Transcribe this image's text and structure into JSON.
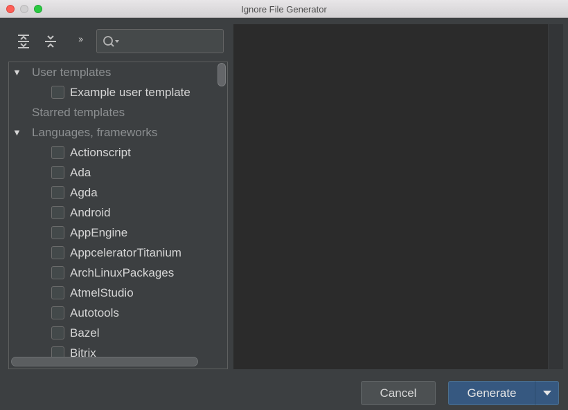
{
  "window": {
    "title": "Ignore File Generator"
  },
  "toolbar": {
    "overflow_label": "››"
  },
  "search": {
    "value": "",
    "placeholder": ""
  },
  "tree": {
    "groups": [
      {
        "label": "User templates",
        "expanded": true,
        "items": [
          "Example user template"
        ]
      },
      {
        "label": "Starred templates",
        "expanded": false,
        "items": []
      },
      {
        "label": "Languages, frameworks",
        "expanded": true,
        "items": [
          "Actionscript",
          "Ada",
          "Agda",
          "Android",
          "AppEngine",
          "AppceleratorTitanium",
          "ArchLinuxPackages",
          "AtmelStudio",
          "Autotools",
          "Bazel",
          "Bitrix"
        ]
      }
    ]
  },
  "buttons": {
    "cancel": "Cancel",
    "generate": "Generate"
  },
  "icons": [
    "expand-all-icon",
    "collapse-all-icon",
    "search-icon",
    "triangle-down-icon",
    "dropdown-arrow-icon"
  ],
  "colors": {
    "background": "#3c3f41",
    "editor": "#2b2b2b",
    "primary_button": "#365880"
  }
}
